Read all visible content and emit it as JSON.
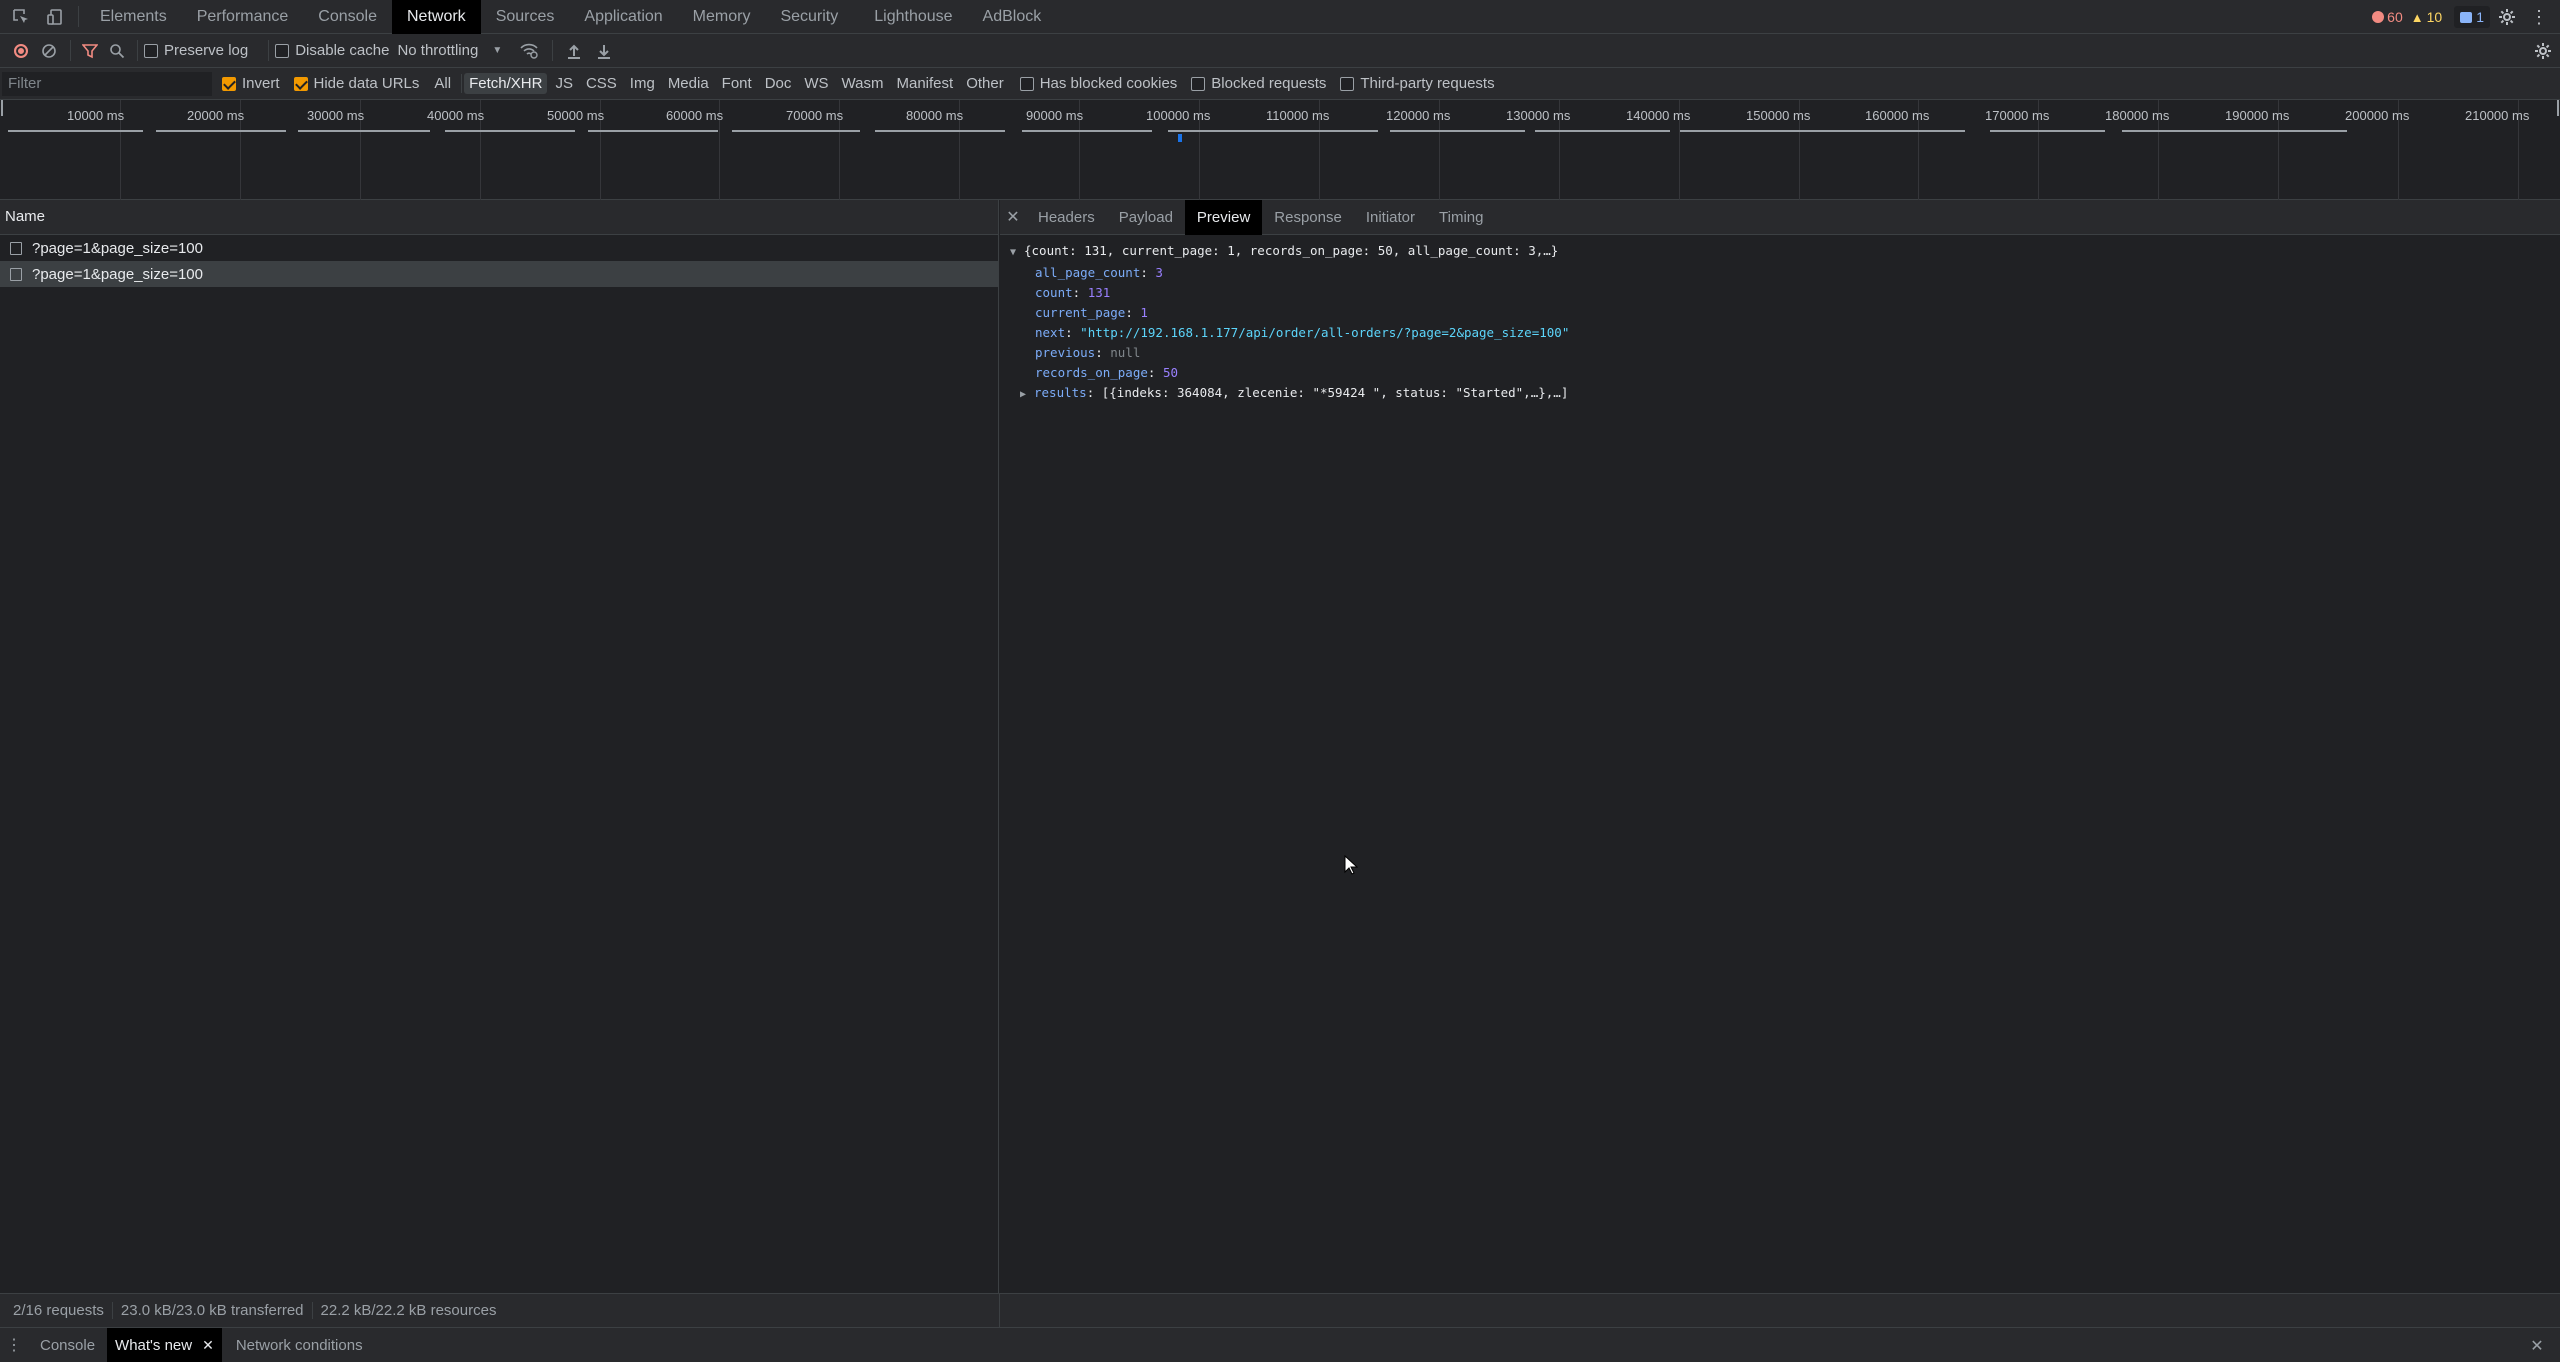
{
  "tabs": [
    "Elements",
    "Performance",
    "Console",
    "Network",
    "Sources",
    "Application",
    "Memory",
    "Security",
    "Lighthouse",
    "AdBlock"
  ],
  "active_tab": "Network",
  "badges": {
    "errors": "60",
    "warnings": "10",
    "messages": "1"
  },
  "toolbar": {
    "preserve_log": "Preserve log",
    "disable_cache": "Disable cache",
    "throttling": "No throttling"
  },
  "filterbar": {
    "placeholder": "Filter",
    "invert": "Invert",
    "hide_data_urls": "Hide data URLs",
    "types": [
      "All",
      "Fetch/XHR",
      "JS",
      "CSS",
      "Img",
      "Media",
      "Font",
      "Doc",
      "WS",
      "Wasm",
      "Manifest",
      "Other"
    ],
    "active_type": "Fetch/XHR",
    "has_blocked_cookies": "Has blocked cookies",
    "blocked_requests": "Blocked requests",
    "third_party": "Third-party requests"
  },
  "timeline": {
    "ticks": [
      "10000 ms",
      "20000 ms",
      "30000 ms",
      "40000 ms",
      "50000 ms",
      "60000 ms",
      "70000 ms",
      "80000 ms",
      "90000 ms",
      "100000 ms",
      "110000 ms",
      "120000 ms",
      "130000 ms",
      "140000 ms",
      "150000 ms",
      "160000 ms",
      "170000 ms",
      "180000 ms",
      "190000 ms",
      "200000 ms",
      "210000 ms"
    ]
  },
  "requests": {
    "header": "Name",
    "rows": [
      "?page=1&page_size=100",
      "?page=1&page_size=100"
    ]
  },
  "details": {
    "tabs": [
      "Headers",
      "Payload",
      "Preview",
      "Response",
      "Initiator",
      "Timing"
    ],
    "active": "Preview",
    "summary": "{count: 131, current_page: 1, records_on_page: 50, all_page_count: 3,…}",
    "fields": [
      {
        "key": "all_page_count",
        "value": "3",
        "kind": "n"
      },
      {
        "key": "count",
        "value": "131",
        "kind": "n"
      },
      {
        "key": "current_page",
        "value": "1",
        "kind": "n"
      },
      {
        "key": "next",
        "value": "\"http://192.168.1.177/api/order/all-orders/?page=2&page_size=100\"",
        "kind": "s"
      },
      {
        "key": "previous",
        "value": "null",
        "kind": "nl"
      },
      {
        "key": "records_on_page",
        "value": "50",
        "kind": "n"
      }
    ],
    "results_key": "results",
    "results_summary": "[{indeks: 364084, zlecenie: \"*59424 \", status: \"Started\",…},…]"
  },
  "status": {
    "requests": "2/16 requests",
    "transferred": "23.0 kB/23.0 kB transferred",
    "resources": "22.2 kB/22.2 kB resources"
  },
  "drawer": {
    "tabs": [
      "Console",
      "What's new",
      "Network conditions"
    ],
    "active": "What's new"
  }
}
